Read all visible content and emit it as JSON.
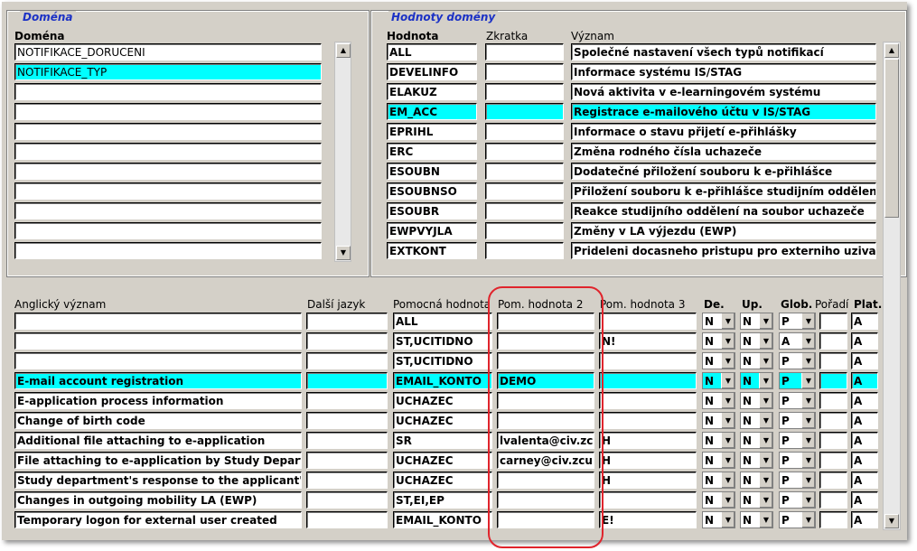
{
  "domena_group": {
    "title": "Doména",
    "column": "Doména",
    "items": [
      "NOTIFIKACE_DORUCENI",
      "NOTIFIKACE_TYP",
      "",
      "",
      "",
      "",
      "",
      "",
      "",
      "",
      ""
    ],
    "selected_index": 1
  },
  "hodnoty_group": {
    "title": "Hodnoty domény",
    "columns": {
      "hodnota": "Hodnota",
      "zkratka": "Zkratka",
      "vyznam": "Význam"
    },
    "selected_index": 3,
    "rows": [
      {
        "hodnota": "ALL",
        "zkratka": "",
        "vyznam": "Společné nastavení všech typů notifikací"
      },
      {
        "hodnota": "DEVELINFO",
        "zkratka": "",
        "vyznam": "Informace systému IS/STAG"
      },
      {
        "hodnota": "ELAKUZ",
        "zkratka": "",
        "vyznam": "Nová aktivita v e-learningovém systému"
      },
      {
        "hodnota": "EM_ACC",
        "zkratka": "",
        "vyznam": "Registrace e-mailového účtu v IS/STAG"
      },
      {
        "hodnota": "EPRIHL",
        "zkratka": "",
        "vyznam": "Informace o stavu přijetí e-přihlášky"
      },
      {
        "hodnota": "ERC",
        "zkratka": "",
        "vyznam": "Změna rodného čísla uchazeče"
      },
      {
        "hodnota": "ESOUBN",
        "zkratka": "",
        "vyznam": "Dodatečné přiložení souboru k e-přihlášce"
      },
      {
        "hodnota": "ESOUBNSO",
        "zkratka": "",
        "vyznam": "Přiložení souboru k e-přihlášce studijním oddělením"
      },
      {
        "hodnota": "ESOUBR",
        "zkratka": "",
        "vyznam": "Reakce studijního oddělení na soubor uchazeče"
      },
      {
        "hodnota": "EWPVYJLA",
        "zkratka": "",
        "vyznam": "Změny v LA výjezdu (EWP)"
      },
      {
        "hodnota": "EXTKONT",
        "zkratka": "",
        "vyznam": "Prideleni docasneho pristupu pro externiho uzivatele"
      }
    ]
  },
  "detail": {
    "columns": {
      "anglicky": "Anglický význam",
      "dalsi": "Další jazyk",
      "pom1": "Pomocná hodnota",
      "pom2": "Pom. hodnota 2",
      "pom3": "Pom. hodnota 3",
      "de": "De.",
      "up": "Up.",
      "glob": "Glob.",
      "poradi": "Pořadí",
      "plat": "Plat."
    },
    "selected_index": 3,
    "rows": [
      {
        "anglicky": "",
        "dalsi": "",
        "pom1": "ALL",
        "pom2": "",
        "pom3": "",
        "de": "N",
        "up": "N",
        "glob": "P",
        "poradi": "",
        "plat": "A"
      },
      {
        "anglicky": "",
        "dalsi": "",
        "pom1": "ST,UCITIDNO",
        "pom2": "",
        "pom3": "N!",
        "de": "N",
        "up": "N",
        "glob": "A",
        "poradi": "",
        "plat": "A"
      },
      {
        "anglicky": "",
        "dalsi": "",
        "pom1": "ST,UCITIDNO",
        "pom2": "",
        "pom3": "",
        "de": "N",
        "up": "N",
        "glob": "P",
        "poradi": "",
        "plat": "A"
      },
      {
        "anglicky": "E-mail account registration",
        "dalsi": "",
        "pom1": "EMAIL_KONTO",
        "pom2": "DEMO",
        "pom3": "",
        "de": "N",
        "up": "N",
        "glob": "P",
        "poradi": "",
        "plat": "A"
      },
      {
        "anglicky": "E-application process information",
        "dalsi": "",
        "pom1": "UCHAZEC",
        "pom2": "",
        "pom3": "",
        "de": "N",
        "up": "N",
        "glob": "P",
        "poradi": "",
        "plat": "A"
      },
      {
        "anglicky": "Change of birth code",
        "dalsi": "",
        "pom1": "UCHAZEC",
        "pom2": "",
        "pom3": "",
        "de": "N",
        "up": "N",
        "glob": "P",
        "poradi": "",
        "plat": "A"
      },
      {
        "anglicky": "Additional file attaching to e-application",
        "dalsi": "",
        "pom1": "SR",
        "pom2": "lvalenta@civ.zcu",
        "pom3": "H",
        "de": "N",
        "up": "N",
        "glob": "P",
        "poradi": "",
        "plat": "A"
      },
      {
        "anglicky": "File attaching to e-application by Study Departme",
        "dalsi": "",
        "pom1": "UCHAZEC",
        "pom2": "carney@civ.zcu.c",
        "pom3": "H",
        "de": "N",
        "up": "N",
        "glob": "P",
        "poradi": "",
        "plat": "A"
      },
      {
        "anglicky": "Study department's response to the applicant's file",
        "dalsi": "",
        "pom1": "UCHAZEC",
        "pom2": "",
        "pom3": "H",
        "de": "N",
        "up": "N",
        "glob": "P",
        "poradi": "",
        "plat": "A"
      },
      {
        "anglicky": "Changes in outgoing mobility LA (EWP)",
        "dalsi": "",
        "pom1": "ST,EI,EP",
        "pom2": "",
        "pom3": "",
        "de": "N",
        "up": "N",
        "glob": "P",
        "poradi": "",
        "plat": "A"
      },
      {
        "anglicky": "Temporary logon for external user created",
        "dalsi": "",
        "pom1": "EMAIL_KONTO",
        "pom2": "",
        "pom3": "E!",
        "de": "N",
        "up": "N",
        "glob": "P",
        "poradi": "",
        "plat": "A"
      }
    ]
  },
  "colors": {
    "selection": "#00ffff",
    "window_bg": "#d4d0c8",
    "legend": "#1b31c5",
    "highlight_box": "#e0242c"
  },
  "icons": {
    "scroll_up": "▲",
    "scroll_down": "▼",
    "dropdown": "▼"
  }
}
